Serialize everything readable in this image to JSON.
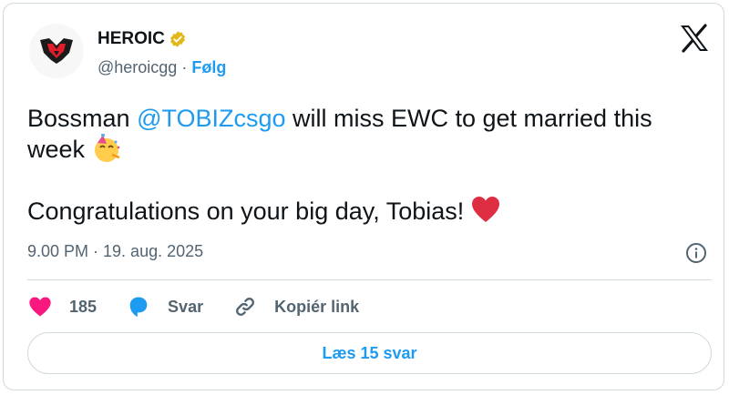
{
  "account": {
    "name": "HEROIC",
    "handle": "@heroicgg",
    "separator": "·",
    "follow_label": "Følg"
  },
  "tweet": {
    "line1_before": "Bossman ",
    "mention": "@TOBIZcsgo",
    "line1_after": " will miss EWC to get married this week ",
    "line2": "Congratulations on your big day, Tobias! ",
    "timestamp": "9.00 PM · 19. aug. 2025"
  },
  "actions": {
    "likes": "185",
    "reply_label": "Svar",
    "copy_label": "Kopiér link"
  },
  "read_replies_label": "Læs 15 svar",
  "colors": {
    "accent": "#1d9bf0",
    "like": "#f91880",
    "verified": "#e2b719",
    "muted": "#536471"
  },
  "icons": [
    "x-logo-icon",
    "verified-badge-icon",
    "party-face-emoji",
    "heart-emoji",
    "info-icon",
    "heart-icon",
    "reply-bubble-icon",
    "link-icon"
  ]
}
